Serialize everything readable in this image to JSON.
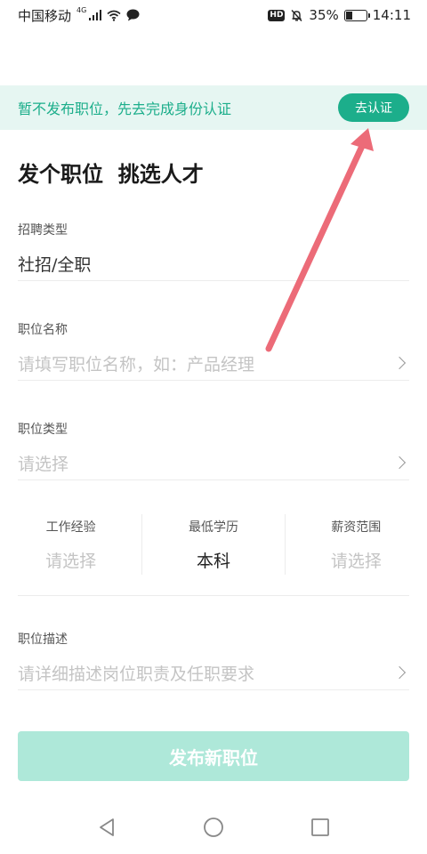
{
  "status_bar": {
    "carrier": "中国移动",
    "network": "4G",
    "hd": "HD",
    "battery_percent": "35%",
    "battery_level": 0.35,
    "time": "14:11",
    "icons": [
      "signal-icon",
      "wifi-icon",
      "chat-icon",
      "hd-icon",
      "mute-bell-icon",
      "battery-icon"
    ]
  },
  "banner": {
    "text": "暂不发布职位，先去完成身份认证",
    "button": "去认证"
  },
  "page_title": "发个职位  挑选人才",
  "fields": {
    "recruit_type": {
      "label": "招聘类型",
      "value": "社招/全职"
    },
    "job_name": {
      "label": "职位名称",
      "placeholder": "请填写职位名称，如：产品经理"
    },
    "job_type": {
      "label": "职位类型",
      "placeholder": "请选择"
    },
    "job_desc": {
      "label": "职位描述",
      "placeholder": "请详细描述岗位职责及任职要求"
    }
  },
  "triple": {
    "experience": {
      "label": "工作经验",
      "value": "请选择"
    },
    "education": {
      "label": "最低学历",
      "value": "本科"
    },
    "salary": {
      "label": "薪资范围",
      "value": "请选择"
    }
  },
  "publish_button": "发布新职位",
  "nav": {
    "icons": [
      "back-triangle-icon",
      "home-circle-icon",
      "recents-square-icon"
    ]
  },
  "colors": {
    "accent": "#1cae8b",
    "banner_bg": "#e6f6f2",
    "publish_disabled": "#aee8d9",
    "annotation_arrow": "#ec6b78"
  }
}
